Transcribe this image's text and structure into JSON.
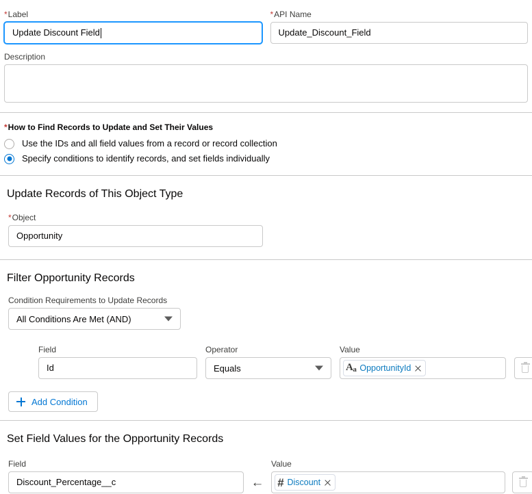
{
  "form": {
    "label_field": {
      "label": "Label",
      "required": true,
      "value": "Update Discount Field",
      "focused": true
    },
    "api_name_field": {
      "label": "API Name",
      "required": true,
      "value": "Update_Discount_Field"
    },
    "description_field": {
      "label": "Description",
      "value": "",
      "placeholder": ""
    }
  },
  "how_to_find": {
    "title": "How to Find Records to Update and Set Their Values",
    "required": true,
    "options": [
      {
        "label": "Use the IDs and all field values from a record or record collection",
        "selected": false
      },
      {
        "label": "Specify conditions to identify records, and set fields individually",
        "selected": true
      }
    ]
  },
  "object_section": {
    "title": "Update Records of This Object Type",
    "object_label": "Object",
    "object_required": true,
    "object_value": "Opportunity"
  },
  "filter_section": {
    "title": "Filter Opportunity Records",
    "condition_requirements_label": "Condition Requirements to Update Records",
    "condition_requirements_value": "All Conditions Are Met (AND)",
    "columns": {
      "field": "Field",
      "operator": "Operator",
      "value": "Value"
    },
    "conditions": [
      {
        "field": "Id",
        "operator": "Equals",
        "value_pill": {
          "icon": "text-type-icon",
          "icon_glyph": "Aa",
          "text": "OpportunityId"
        }
      }
    ],
    "add_condition_label": "Add Condition",
    "add_condition_icon": "plus-icon",
    "delete_icon": "trash-icon"
  },
  "assignment_section": {
    "title": "Set Field Values for the Opportunity Records",
    "columns": {
      "field": "Field",
      "value": "Value"
    },
    "arrow_icon": "left-arrow-icon",
    "assignments": [
      {
        "field": "Discount_Percentage__c",
        "value_pill": {
          "icon": "number-type-icon",
          "icon_glyph": "#",
          "text": "Discount"
        }
      }
    ],
    "delete_icon": "trash-icon"
  },
  "colors": {
    "accent_blue": "#0176d3",
    "pill_text_blue": "#0b7abf",
    "required_red": "#c23934",
    "border_gray": "#c9c9c9",
    "focus_blue": "#1b96ff"
  }
}
